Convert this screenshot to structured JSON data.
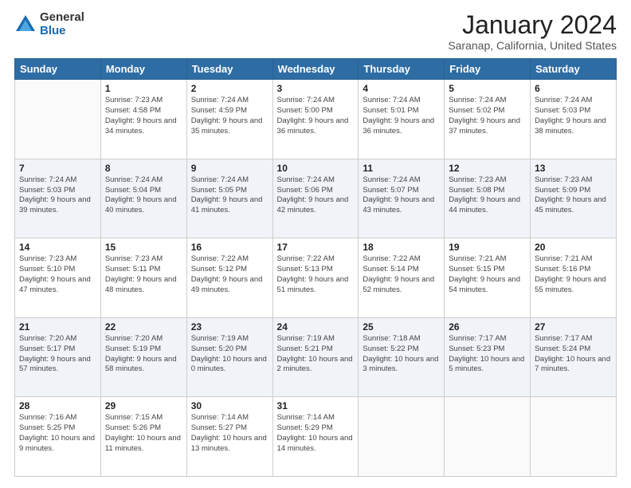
{
  "logo": {
    "general": "General",
    "blue": "Blue"
  },
  "title": "January 2024",
  "subtitle": "Saranap, California, United States",
  "days_header": [
    "Sunday",
    "Monday",
    "Tuesday",
    "Wednesday",
    "Thursday",
    "Friday",
    "Saturday"
  ],
  "weeks": [
    [
      {
        "day": "",
        "sunrise": "",
        "sunset": "",
        "daylight": ""
      },
      {
        "day": "1",
        "sunrise": "Sunrise: 7:23 AM",
        "sunset": "Sunset: 4:58 PM",
        "daylight": "Daylight: 9 hours and 34 minutes."
      },
      {
        "day": "2",
        "sunrise": "Sunrise: 7:24 AM",
        "sunset": "Sunset: 4:59 PM",
        "daylight": "Daylight: 9 hours and 35 minutes."
      },
      {
        "day": "3",
        "sunrise": "Sunrise: 7:24 AM",
        "sunset": "Sunset: 5:00 PM",
        "daylight": "Daylight: 9 hours and 36 minutes."
      },
      {
        "day": "4",
        "sunrise": "Sunrise: 7:24 AM",
        "sunset": "Sunset: 5:01 PM",
        "daylight": "Daylight: 9 hours and 36 minutes."
      },
      {
        "day": "5",
        "sunrise": "Sunrise: 7:24 AM",
        "sunset": "Sunset: 5:02 PM",
        "daylight": "Daylight: 9 hours and 37 minutes."
      },
      {
        "day": "6",
        "sunrise": "Sunrise: 7:24 AM",
        "sunset": "Sunset: 5:03 PM",
        "daylight": "Daylight: 9 hours and 38 minutes."
      }
    ],
    [
      {
        "day": "7",
        "sunrise": "Sunrise: 7:24 AM",
        "sunset": "Sunset: 5:03 PM",
        "daylight": "Daylight: 9 hours and 39 minutes."
      },
      {
        "day": "8",
        "sunrise": "Sunrise: 7:24 AM",
        "sunset": "Sunset: 5:04 PM",
        "daylight": "Daylight: 9 hours and 40 minutes."
      },
      {
        "day": "9",
        "sunrise": "Sunrise: 7:24 AM",
        "sunset": "Sunset: 5:05 PM",
        "daylight": "Daylight: 9 hours and 41 minutes."
      },
      {
        "day": "10",
        "sunrise": "Sunrise: 7:24 AM",
        "sunset": "Sunset: 5:06 PM",
        "daylight": "Daylight: 9 hours and 42 minutes."
      },
      {
        "day": "11",
        "sunrise": "Sunrise: 7:24 AM",
        "sunset": "Sunset: 5:07 PM",
        "daylight": "Daylight: 9 hours and 43 minutes."
      },
      {
        "day": "12",
        "sunrise": "Sunrise: 7:23 AM",
        "sunset": "Sunset: 5:08 PM",
        "daylight": "Daylight: 9 hours and 44 minutes."
      },
      {
        "day": "13",
        "sunrise": "Sunrise: 7:23 AM",
        "sunset": "Sunset: 5:09 PM",
        "daylight": "Daylight: 9 hours and 45 minutes."
      }
    ],
    [
      {
        "day": "14",
        "sunrise": "Sunrise: 7:23 AM",
        "sunset": "Sunset: 5:10 PM",
        "daylight": "Daylight: 9 hours and 47 minutes."
      },
      {
        "day": "15",
        "sunrise": "Sunrise: 7:23 AM",
        "sunset": "Sunset: 5:11 PM",
        "daylight": "Daylight: 9 hours and 48 minutes."
      },
      {
        "day": "16",
        "sunrise": "Sunrise: 7:22 AM",
        "sunset": "Sunset: 5:12 PM",
        "daylight": "Daylight: 9 hours and 49 minutes."
      },
      {
        "day": "17",
        "sunrise": "Sunrise: 7:22 AM",
        "sunset": "Sunset: 5:13 PM",
        "daylight": "Daylight: 9 hours and 51 minutes."
      },
      {
        "day": "18",
        "sunrise": "Sunrise: 7:22 AM",
        "sunset": "Sunset: 5:14 PM",
        "daylight": "Daylight: 9 hours and 52 minutes."
      },
      {
        "day": "19",
        "sunrise": "Sunrise: 7:21 AM",
        "sunset": "Sunset: 5:15 PM",
        "daylight": "Daylight: 9 hours and 54 minutes."
      },
      {
        "day": "20",
        "sunrise": "Sunrise: 7:21 AM",
        "sunset": "Sunset: 5:16 PM",
        "daylight": "Daylight: 9 hours and 55 minutes."
      }
    ],
    [
      {
        "day": "21",
        "sunrise": "Sunrise: 7:20 AM",
        "sunset": "Sunset: 5:17 PM",
        "daylight": "Daylight: 9 hours and 57 minutes."
      },
      {
        "day": "22",
        "sunrise": "Sunrise: 7:20 AM",
        "sunset": "Sunset: 5:19 PM",
        "daylight": "Daylight: 9 hours and 58 minutes."
      },
      {
        "day": "23",
        "sunrise": "Sunrise: 7:19 AM",
        "sunset": "Sunset: 5:20 PM",
        "daylight": "Daylight: 10 hours and 0 minutes."
      },
      {
        "day": "24",
        "sunrise": "Sunrise: 7:19 AM",
        "sunset": "Sunset: 5:21 PM",
        "daylight": "Daylight: 10 hours and 2 minutes."
      },
      {
        "day": "25",
        "sunrise": "Sunrise: 7:18 AM",
        "sunset": "Sunset: 5:22 PM",
        "daylight": "Daylight: 10 hours and 3 minutes."
      },
      {
        "day": "26",
        "sunrise": "Sunrise: 7:17 AM",
        "sunset": "Sunset: 5:23 PM",
        "daylight": "Daylight: 10 hours and 5 minutes."
      },
      {
        "day": "27",
        "sunrise": "Sunrise: 7:17 AM",
        "sunset": "Sunset: 5:24 PM",
        "daylight": "Daylight: 10 hours and 7 minutes."
      }
    ],
    [
      {
        "day": "28",
        "sunrise": "Sunrise: 7:16 AM",
        "sunset": "Sunset: 5:25 PM",
        "daylight": "Daylight: 10 hours and 9 minutes."
      },
      {
        "day": "29",
        "sunrise": "Sunrise: 7:15 AM",
        "sunset": "Sunset: 5:26 PM",
        "daylight": "Daylight: 10 hours and 11 minutes."
      },
      {
        "day": "30",
        "sunrise": "Sunrise: 7:14 AM",
        "sunset": "Sunset: 5:27 PM",
        "daylight": "Daylight: 10 hours and 13 minutes."
      },
      {
        "day": "31",
        "sunrise": "Sunrise: 7:14 AM",
        "sunset": "Sunset: 5:29 PM",
        "daylight": "Daylight: 10 hours and 14 minutes."
      },
      {
        "day": "",
        "sunrise": "",
        "sunset": "",
        "daylight": ""
      },
      {
        "day": "",
        "sunrise": "",
        "sunset": "",
        "daylight": ""
      },
      {
        "day": "",
        "sunrise": "",
        "sunset": "",
        "daylight": ""
      }
    ]
  ]
}
